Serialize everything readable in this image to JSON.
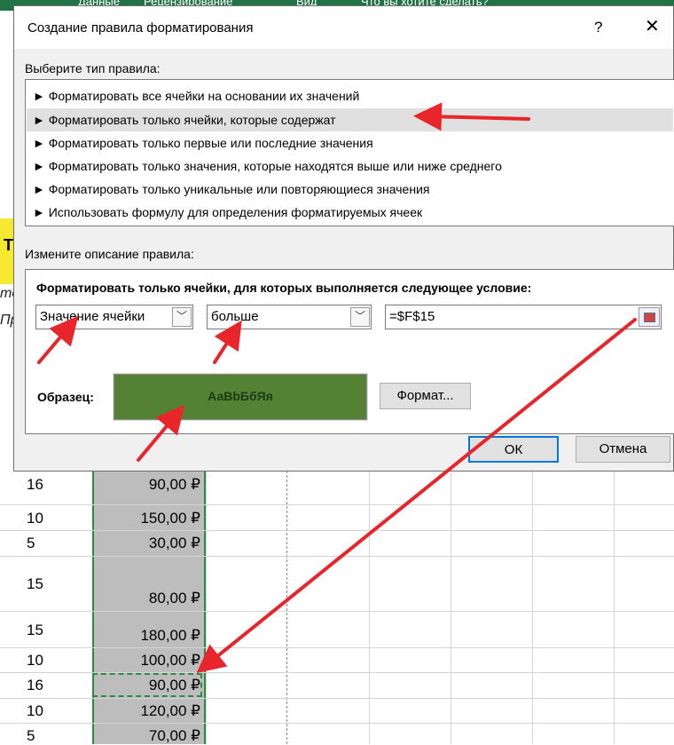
{
  "ribbon": {
    "tabs": [
      "Данные",
      "Рецензирование",
      "Вид",
      "Что вы хотите сделать?"
    ]
  },
  "dialog": {
    "title": "Создание правила форматирования",
    "help_symbol": "?",
    "close_symbol": "✕",
    "select_type_label": "Выберите тип правила:",
    "rule_types": [
      "► Форматировать все ячейки на основании их значений",
      "► Форматировать только ячейки, которые содержат",
      "► Форматировать только первые или последние значения",
      "► Форматировать только значения, которые находятся выше или ниже среднего",
      "► Форматировать только уникальные или повторяющиеся значения",
      "► Использовать формулу для определения форматируемых ячеек"
    ],
    "selected_rule_index": 1,
    "edit_description_label": "Измените описание правила:",
    "condition_heading": "Форматировать только ячейки, для которых выполняется следующее условие:",
    "condition_field": "Значение ячейки",
    "operator": "больше",
    "value": "=$F$15",
    "sample_label": "Образец:",
    "sample_text": "АаВbБбЯя",
    "format_button": "Формат...",
    "ok_button": "ОК",
    "cancel_button": "Отмена"
  },
  "sheet": {
    "left_header_char": "Т",
    "left_italic_1": "те",
    "left_italic_2": "Пр",
    "rows": [
      {
        "a": "16",
        "b": "90,00 ₽"
      },
      {
        "a": "10",
        "b": "150,00 ₽"
      },
      {
        "a": "5",
        "b": "30,00 ₽"
      },
      {
        "a": "15",
        "b": "80,00 ₽"
      },
      {
        "a": "15",
        "b": "180,00 ₽"
      },
      {
        "a": "10",
        "b": "100,00 ₽"
      },
      {
        "a": "16",
        "b": "90,00 ₽"
      },
      {
        "a": "10",
        "b": "120,00 ₽"
      },
      {
        "a": "5",
        "b": "70,00 ₽"
      }
    ]
  },
  "colors": {
    "accent": "#217346",
    "sample_fill": "#548235",
    "arrow": "#e8252a",
    "selection_border": "#2e8b47"
  }
}
